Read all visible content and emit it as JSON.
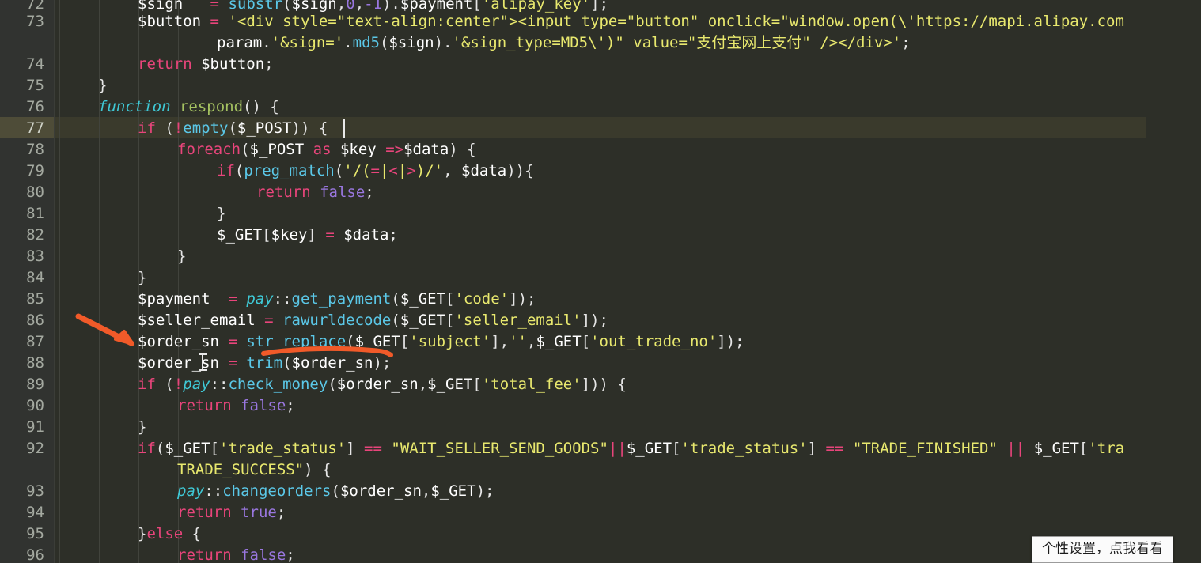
{
  "editor": {
    "theme_name": "dark-monokai-like",
    "background_color": "#2d2f28",
    "gutter_color": "#313330",
    "current_line": 77,
    "first_visible_line": 72,
    "last_visible_line": 96,
    "line_numbers": [
      72,
      73,
      74,
      75,
      76,
      77,
      78,
      79,
      80,
      81,
      82,
      83,
      84,
      85,
      86,
      87,
      88,
      89,
      90,
      91,
      92,
      93,
      94,
      95,
      96
    ],
    "language": "PHP"
  },
  "colors": {
    "keyword": "#e8457b",
    "function_decl": "#a5c261",
    "type_italic": "#3fc9d6",
    "function_call": "#5bc8e8",
    "string": "#e8e86e",
    "variable": "#ffffff",
    "boolean": "#9a77e0",
    "line_number": "#a4a9a0",
    "current_line_highlight": "#3a3a2c",
    "gutter_highlight": "#4e4c38",
    "annotation_orange": "#f15a29"
  },
  "code_lines": [
    {
      "number": 72,
      "clipped_top": true,
      "text": "        $sign   = substr($sign,0,-1).$payment['alipay_key'];"
    },
    {
      "number": 73,
      "text": "        $button = '<div style=\"text-align:center\"><input type=\"button\" onclick=\"window.open(\\'https://mapi.alipay.com"
    },
    {
      "number": 73,
      "continuation": true,
      "text": "            param.'&sign='.md5($sign).'&sign_type=MD5\\')\" value=\"支付宝网上支付\" /></div>';"
    },
    {
      "number": 74,
      "text": "        return $button;"
    },
    {
      "number": 75,
      "text": "    }"
    },
    {
      "number": 76,
      "text": "    function respond() {"
    },
    {
      "number": 77,
      "text": "        if (!empty($_POST)) {"
    },
    {
      "number": 78,
      "text": "            foreach($_POST as $key =>$data) {"
    },
    {
      "number": 79,
      "text": "                if(preg_match('/(=|<|>)/', $data)){"
    },
    {
      "number": 80,
      "text": "                    return false;"
    },
    {
      "number": 81,
      "text": "                }"
    },
    {
      "number": 82,
      "text": "                $_GET[$key] = $data;"
    },
    {
      "number": 83,
      "text": "            }"
    },
    {
      "number": 84,
      "text": "        }"
    },
    {
      "number": 85,
      "text": "        $payment  = pay::get_payment($_GET['code']);"
    },
    {
      "number": 86,
      "text": "        $seller_email = rawurldecode($_GET['seller_email']);"
    },
    {
      "number": 87,
      "text": "        $order_sn = str_replace($_GET['subject'],'',$_GET['out_trade_no']);"
    },
    {
      "number": 88,
      "text": "        $order_sn = trim($order_sn);"
    },
    {
      "number": 89,
      "text": "        if (!pay::check_money($order_sn,$_GET['total_fee'])) {"
    },
    {
      "number": 90,
      "text": "            return false;"
    },
    {
      "number": 91,
      "text": "        }"
    },
    {
      "number": 92,
      "text": "        if($_GET['trade_status'] == \"WAIT_SELLER_SEND_GOODS\"||$_GET['trade_status'] == \"TRADE_FINISHED\" || $_GET['tra"
    },
    {
      "number": 92,
      "continuation": true,
      "text": "            TRADE_SUCCESS\") {"
    },
    {
      "number": 93,
      "text": "            pay::changeorders($order_sn,$_GET);"
    },
    {
      "number": 94,
      "text": "            return true;"
    },
    {
      "number": 95,
      "text": "        }else {"
    },
    {
      "number": 96,
      "text": "            return false;"
    }
  ],
  "annotations": {
    "arrow": {
      "name": "red-arrow-annotation",
      "points_to_line": 87,
      "color": "#f15a29"
    },
    "underline": {
      "name": "underline-annotation",
      "under_token": "str_replace",
      "on_line": 87,
      "color": "#f15a29"
    }
  },
  "cursors": {
    "text_caret": {
      "line": 77,
      "after_token": "{"
    },
    "mouse_pointer": {
      "shape": "i-beam",
      "line": 88
    }
  },
  "popup": {
    "text": "个性设置，点我看看"
  }
}
